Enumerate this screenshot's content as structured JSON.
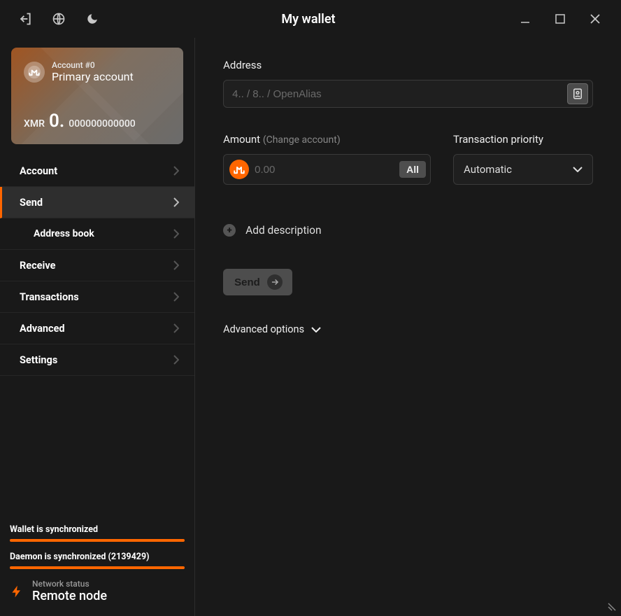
{
  "title": "My wallet",
  "account": {
    "sub": "Account #0",
    "name": "Primary account",
    "ticker": "XMR",
    "balance_int": "0.",
    "balance_frac": "000000000000"
  },
  "nav": {
    "account": "Account",
    "send": "Send",
    "address_book": "Address book",
    "receive": "Receive",
    "transactions": "Transactions",
    "advanced": "Advanced",
    "settings": "Settings"
  },
  "status": {
    "wallet_sync": "Wallet is synchronized",
    "daemon_sync": "Daemon is synchronized (2139429)",
    "network_label": "Network status",
    "network_value": "Remote node"
  },
  "form": {
    "address_label": "Address",
    "address_placeholder": "4.. / 8.. / OpenAlias",
    "amount_label": "Amount",
    "amount_paren": "(Change account)",
    "amount_placeholder": "0.00",
    "all_button": "All",
    "priority_label": "Transaction priority",
    "priority_value": "Automatic",
    "add_description": "Add description",
    "send_button": "Send",
    "advanced_options": "Advanced options"
  }
}
